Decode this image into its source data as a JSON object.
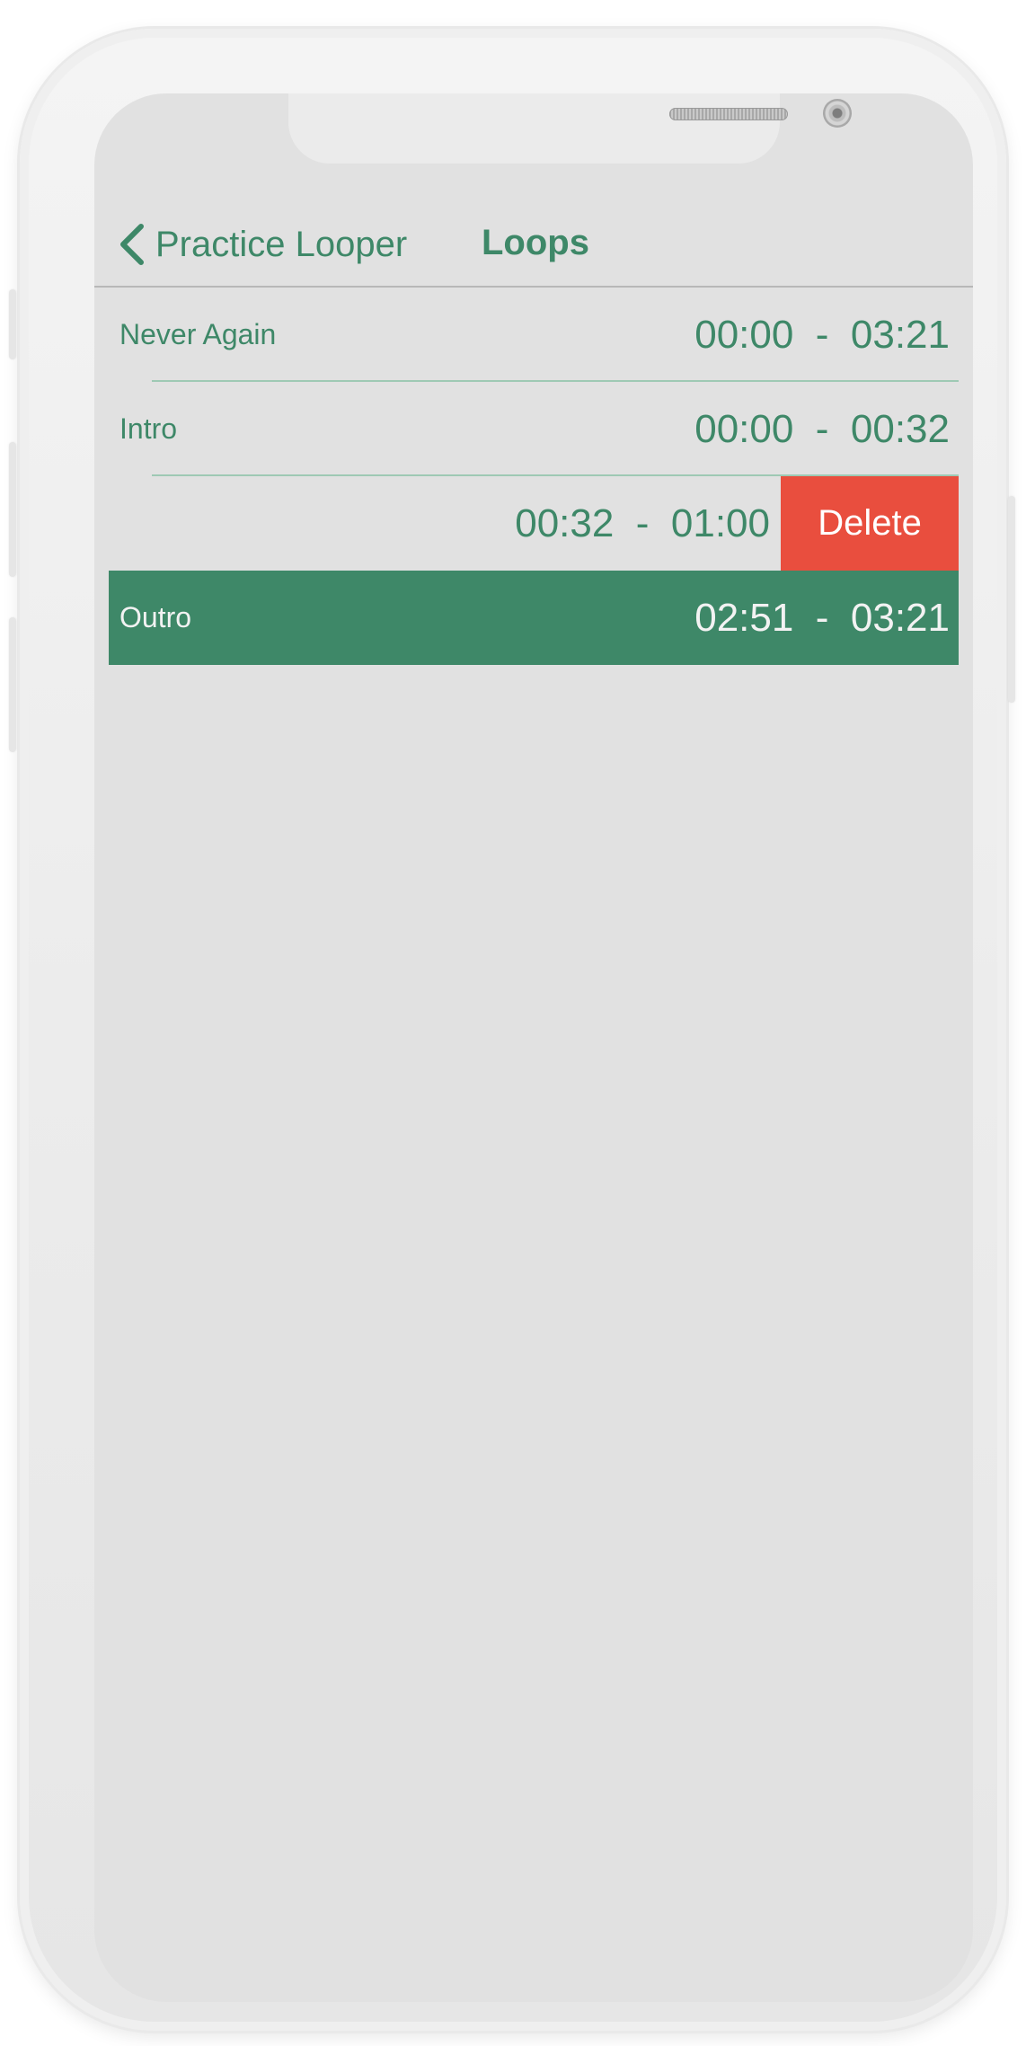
{
  "nav": {
    "back_label": "Practice Looper",
    "title": "Loops"
  },
  "loops": [
    {
      "name": "Never Again",
      "time": "00:00  -  03:21"
    },
    {
      "name": "Intro",
      "time": "00:00  -  00:32"
    },
    {
      "name": "",
      "time": "00:32  -  01:00",
      "swiped": true
    },
    {
      "name": "Outro",
      "time": "02:51  -  03:21",
      "selected": true
    }
  ],
  "delete_label": "Delete",
  "colors": {
    "accent": "#3e8868",
    "delete": "#e94e3e",
    "background": "#e1e1e1"
  }
}
